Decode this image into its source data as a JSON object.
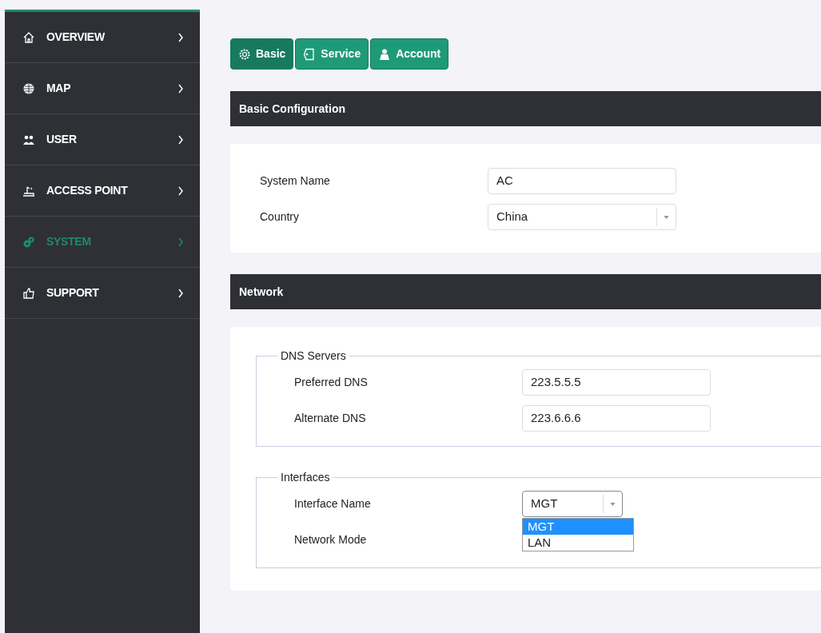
{
  "sidebar": {
    "items": [
      {
        "label": "OVERVIEW",
        "selected": false
      },
      {
        "label": "MAP",
        "selected": false
      },
      {
        "label": "USER",
        "selected": false
      },
      {
        "label": "ACCESS POINT",
        "selected": false
      },
      {
        "label": "SYSTEM",
        "selected": true
      },
      {
        "label": "SUPPORT",
        "selected": false
      }
    ]
  },
  "tabs": [
    {
      "label": "Basic",
      "selected": true
    },
    {
      "label": "Service",
      "selected": false
    },
    {
      "label": "Account",
      "selected": false
    }
  ],
  "basic_configuration": {
    "title": "Basic Configuration",
    "fields": [
      {
        "label": "System Name",
        "kind": "text",
        "value": "AC"
      },
      {
        "label": "Country",
        "kind": "select",
        "value": "China"
      }
    ]
  },
  "network": {
    "title": "Network",
    "fieldsets": [
      {
        "legend": "DNS Servers",
        "fields": [
          {
            "label": "Preferred DNS",
            "kind": "text",
            "value": "223.5.5.5"
          },
          {
            "label": "Alternate DNS",
            "kind": "text",
            "value": "223.6.6.6"
          }
        ]
      },
      {
        "legend": "Interfaces",
        "fields": [
          {
            "label": "Interface Name",
            "kind": "select",
            "value": "MGT",
            "expanded": true,
            "options": [
              {
                "label": "MGT",
                "selected": true
              },
              {
                "label": "LAN",
                "selected": false
              }
            ]
          },
          {
            "label": "Network Mode",
            "kind": "label"
          }
        ]
      }
    ]
  }
}
